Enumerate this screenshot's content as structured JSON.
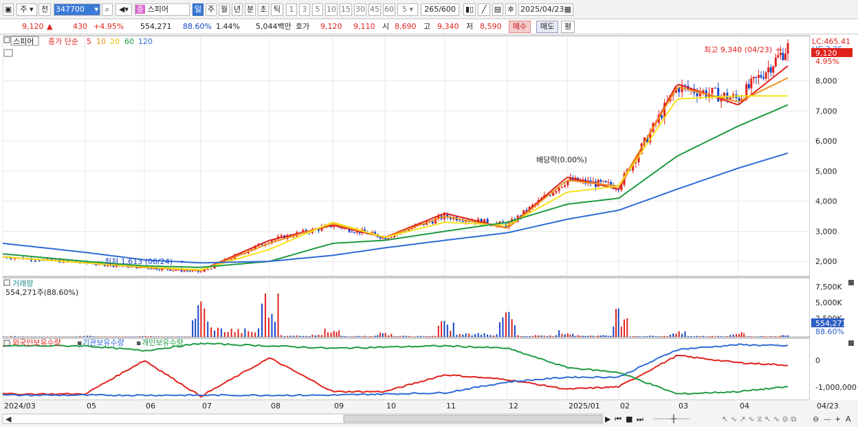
{
  "toolbar": {
    "market": "주",
    "prev": "전",
    "code": "347700",
    "stock_tag": "증",
    "stock_name": "스피어",
    "periods": [
      "일",
      "주",
      "월",
      "년",
      "분",
      "초",
      "틱"
    ],
    "intervals": [
      "1",
      "3",
      "5",
      "10",
      "15",
      "30",
      "45",
      "60"
    ],
    "interval_value": "5",
    "count": "265",
    "count_total": "/600",
    "date": "2025/04/23"
  },
  "quote": {
    "price": "9,120",
    "change_arrow": "▲",
    "change": "430",
    "change_pct": "+4.95%",
    "volume": "554,271",
    "volume_ratio": "88.60%",
    "turnover": "1.44%",
    "amount": "5,044백만",
    "hoga_label": "호가",
    "ask": "9,120",
    "bid": "9,110",
    "open_label": "시",
    "open": "8,690",
    "high_label": "고",
    "high": "9,340",
    "low_label": "저",
    "low": "8,590",
    "buy_label": "매수",
    "sell_label": "매도",
    "avg_label": "평"
  },
  "price_panel": {
    "name": "스피어",
    "indicator": "종가 단순",
    "ma": [
      "5",
      "10",
      "20",
      "60",
      "120"
    ],
    "ma_colors": [
      "#e0211b",
      "#f0901e",
      "#f6e21a",
      "#1e9a43",
      "#2f6bd6"
    ],
    "lc": "LC:465.41",
    "hc_partial": "HC:3.26",
    "price_tag": "9,120",
    "pct_tag": "4.95%",
    "high_annot": "최고 9,340 (04/23)",
    "low_annot": "최저 1,613 (06/24)",
    "div_annot": "배당락(0.00%)",
    "yticks": [
      "8,000",
      "7,000",
      "6,000",
      "5,000",
      "4,000",
      "3,000",
      "2,000"
    ]
  },
  "volume_panel": {
    "name": "거래량",
    "value": "554,271주(88.60%)",
    "yticks": [
      "7,500K",
      "5,000K",
      "2,500K"
    ],
    "tag": "554,271",
    "pct_tag": "88.60%"
  },
  "holdings_panel": {
    "legend": [
      "외국인보유수량",
      "기관보유수량",
      "개인보유수량"
    ],
    "legend_colors": [
      "#e0211b",
      "#2f6bd6",
      "#1e9a43"
    ],
    "yticks": [
      "0",
      "-1,000,000"
    ]
  },
  "xaxis": {
    "labels": [
      "2024/03",
      "05",
      "06",
      "07",
      "08",
      "09",
      "10",
      "11",
      "12",
      "2025/01",
      "02",
      "03",
      "04"
    ],
    "last": "04/23"
  },
  "chart_data": [
    {
      "type": "candlestick",
      "title": "",
      "x": [
        "2024/03",
        "05",
        "06",
        "07",
        "08",
        "09",
        "10",
        "11",
        "12",
        "2025/01",
        "02",
        "03",
        "04",
        "04/23"
      ],
      "close_approx": [
        2150,
        1950,
        1800,
        1650,
        2700,
        3200,
        2800,
        3500,
        3200,
        4700,
        4500,
        7800,
        7400,
        9120
      ],
      "series": [
        {
          "name": "5",
          "values": [
            2150,
            1950,
            1800,
            1700,
            2700,
            3200,
            2800,
            3600,
            3100,
            4800,
            4400,
            7900,
            7200,
            8500
          ]
        },
        {
          "name": "10",
          "values": [
            2150,
            1950,
            1800,
            1700,
            2600,
            3250,
            2800,
            3500,
            3100,
            4700,
            4500,
            7800,
            7300,
            8100
          ]
        },
        {
          "name": "20",
          "values": [
            2150,
            1950,
            1820,
            1720,
            2400,
            3300,
            2800,
            3300,
            3200,
            4300,
            4500,
            7400,
            7500,
            7500
          ]
        },
        {
          "name": "60",
          "values": [
            2250,
            2000,
            1850,
            1800,
            2000,
            2600,
            2700,
            3000,
            3300,
            3900,
            4100,
            5500,
            6500,
            7200
          ]
        },
        {
          "name": "120",
          "values": [
            2600,
            2300,
            2050,
            1950,
            2000,
            2200,
            2450,
            2700,
            2950,
            3400,
            3700,
            4400,
            5100,
            5600
          ]
        }
      ],
      "ylim": [
        1500,
        9500
      ],
      "annotations": [
        "최고 9,340 (04/23)",
        "최저 1,613 (06/24)",
        "배당락(0.00%)"
      ]
    },
    {
      "type": "bar",
      "title": "거래량",
      "x": [
        "2024/03",
        "05",
        "06",
        "07",
        "08",
        "09",
        "10",
        "11",
        "12",
        "2025/01",
        "02",
        "03",
        "04",
        "04/23"
      ],
      "values_k": [
        150,
        200,
        150,
        6500,
        7800,
        1500,
        800,
        2600,
        5200,
        1200,
        5200,
        900,
        800,
        554
      ],
      "ylim_k": [
        0,
        8500
      ]
    },
    {
      "type": "line",
      "title": "",
      "x": [
        "2024/03",
        "05",
        "06",
        "07",
        "08",
        "09",
        "10",
        "11",
        "12",
        "2025/01",
        "02",
        "03",
        "04",
        "04/23"
      ],
      "series": [
        {
          "name": "외국인보유수량",
          "values": [
            -1600000,
            -1600000,
            -200000,
            -1700000,
            -100000,
            -1500000,
            -1500000,
            -800000,
            -1000000,
            -1400000,
            -1300000,
            0,
            -300000,
            -400000
          ]
        },
        {
          "name": "기관보유수량",
          "values": [
            -1650000,
            -1650000,
            -1650000,
            -1650000,
            -1650000,
            -1650000,
            -1600000,
            -1550000,
            -1100000,
            -900000,
            -900000,
            250000,
            450000,
            400000
          ]
        },
        {
          "name": "개인보유수량",
          "values": [
            400000,
            400000,
            200000,
            500000,
            400000,
            300000,
            350000,
            400000,
            300000,
            -500000,
            -700000,
            -1600000,
            -1500000,
            -1300000
          ]
        }
      ],
      "ylim": [
        -1800000,
        600000
      ]
    }
  ]
}
